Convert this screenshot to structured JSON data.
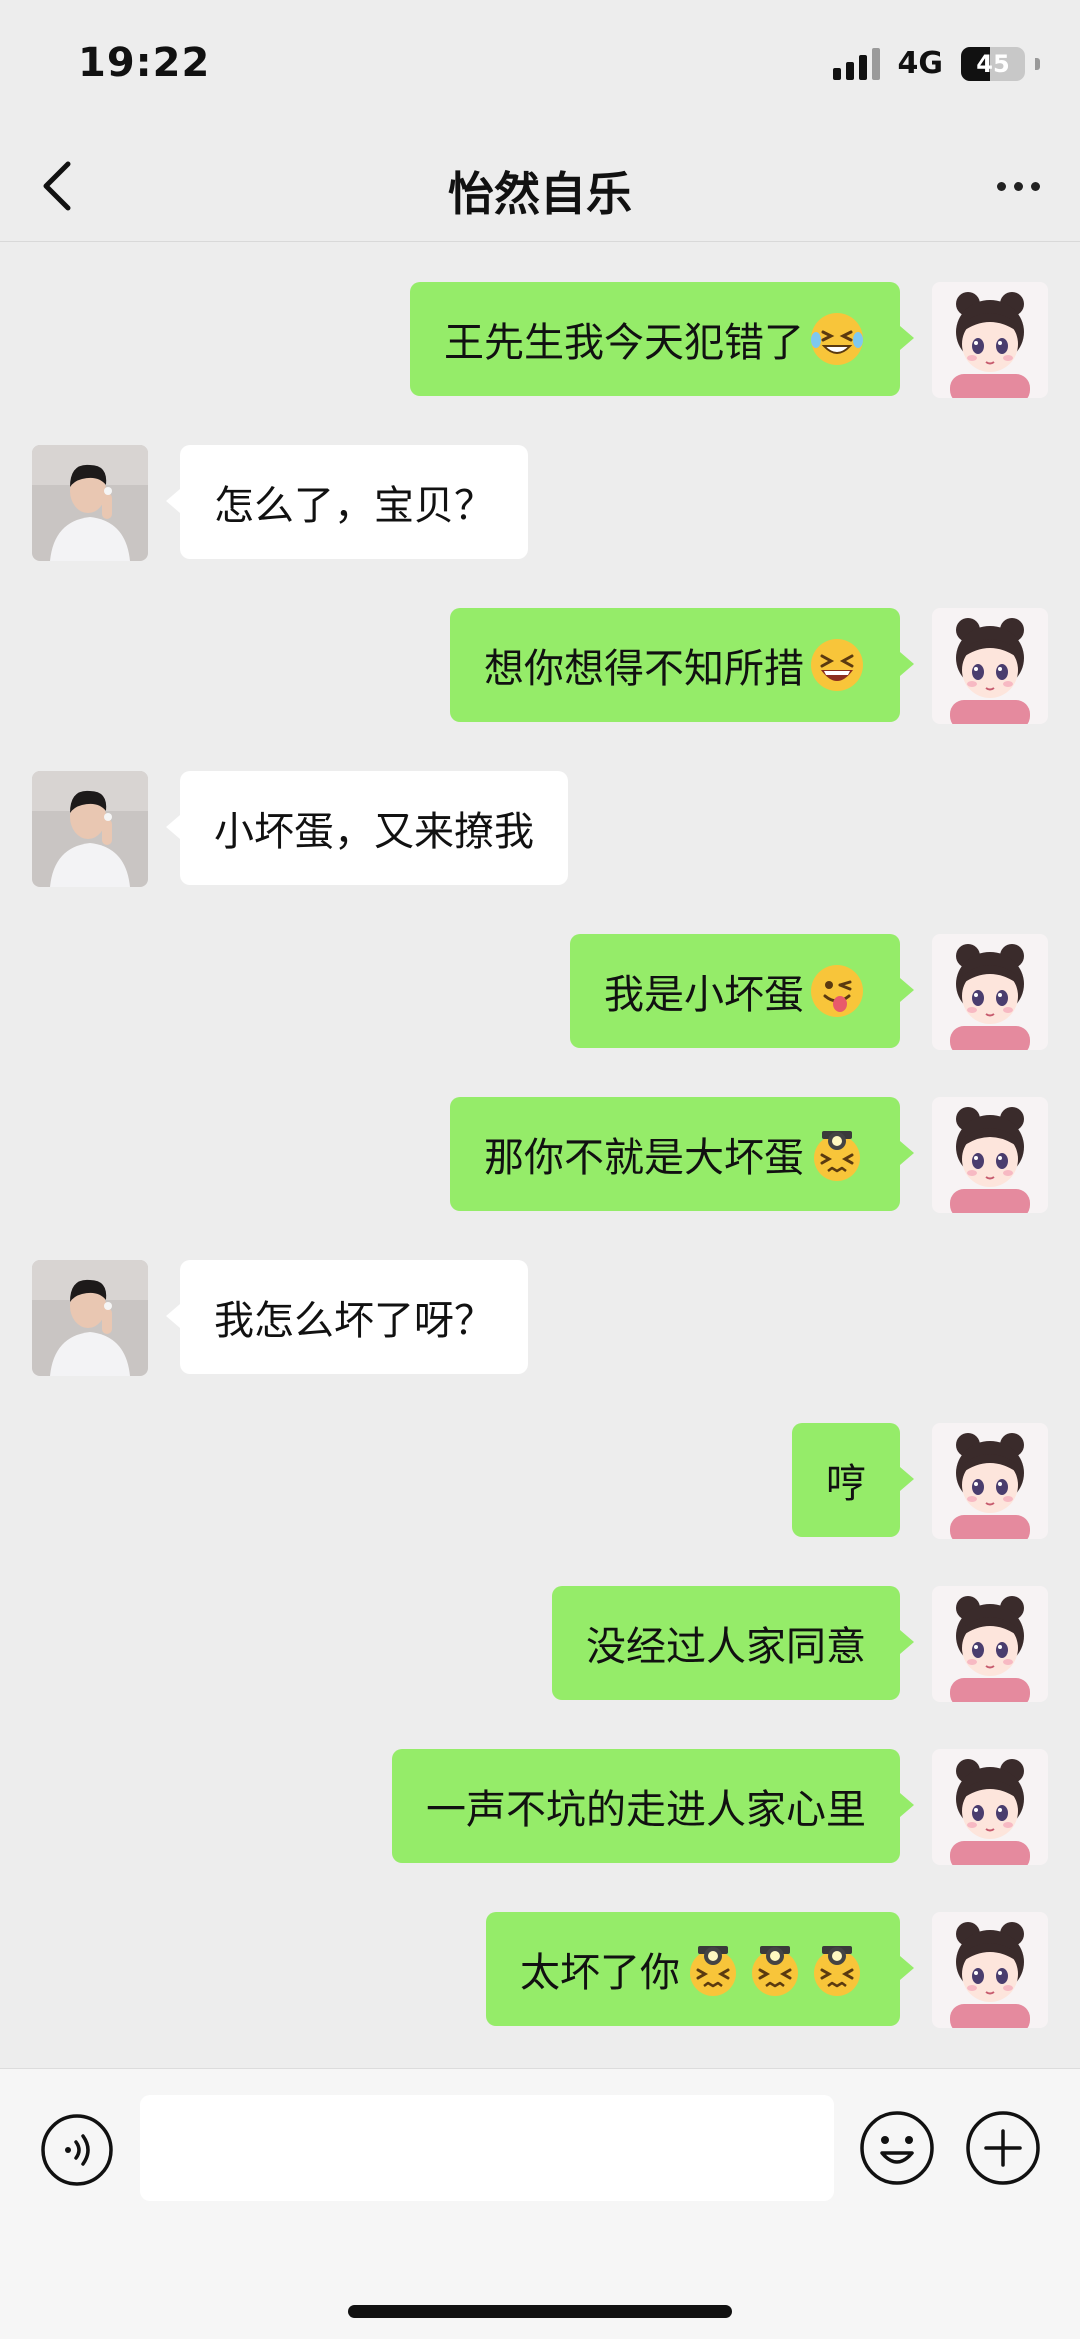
{
  "status_bar": {
    "time": "19:22",
    "network": "4G",
    "battery": "45",
    "battery_level": 0.45
  },
  "header": {
    "title": "怡然自乐"
  },
  "messages": [
    {
      "side": "right",
      "text": "王先生我今天犯错了",
      "emoji": [
        "grinning-squint-sweat"
      ]
    },
    {
      "side": "left",
      "text": "怎么了，宝贝？",
      "emoji": []
    },
    {
      "side": "right",
      "text": "想你想得不知所措",
      "emoji": [
        "laughing-squint"
      ]
    },
    {
      "side": "left",
      "text": "小坏蛋，又来撩我",
      "emoji": []
    },
    {
      "side": "right",
      "text": "我是小坏蛋",
      "emoji": [
        "winking-tongue"
      ]
    },
    {
      "side": "right",
      "text": "那你不就是大坏蛋",
      "emoji": [
        "stressed-light"
      ]
    },
    {
      "side": "left",
      "text": "我怎么坏了呀？",
      "emoji": []
    },
    {
      "side": "right",
      "text": "哼",
      "emoji": []
    },
    {
      "side": "right",
      "text": "没经过人家同意",
      "emoji": []
    },
    {
      "side": "right",
      "text": "一声不坑的走进人家心里",
      "emoji": []
    },
    {
      "side": "right",
      "text": "太坏了你",
      "emoji": [
        "stressed-light",
        "stressed-light",
        "stressed-light"
      ]
    }
  ],
  "icons": {
    "back": "chevron-left-icon",
    "more": "more-dots-icon",
    "voice": "voice-icon",
    "emoji": "smiley-icon",
    "plus": "plus-icon"
  },
  "colors": {
    "background": "#ededed",
    "bubble_sent": "#95ec69",
    "bubble_received": "#ffffff"
  }
}
